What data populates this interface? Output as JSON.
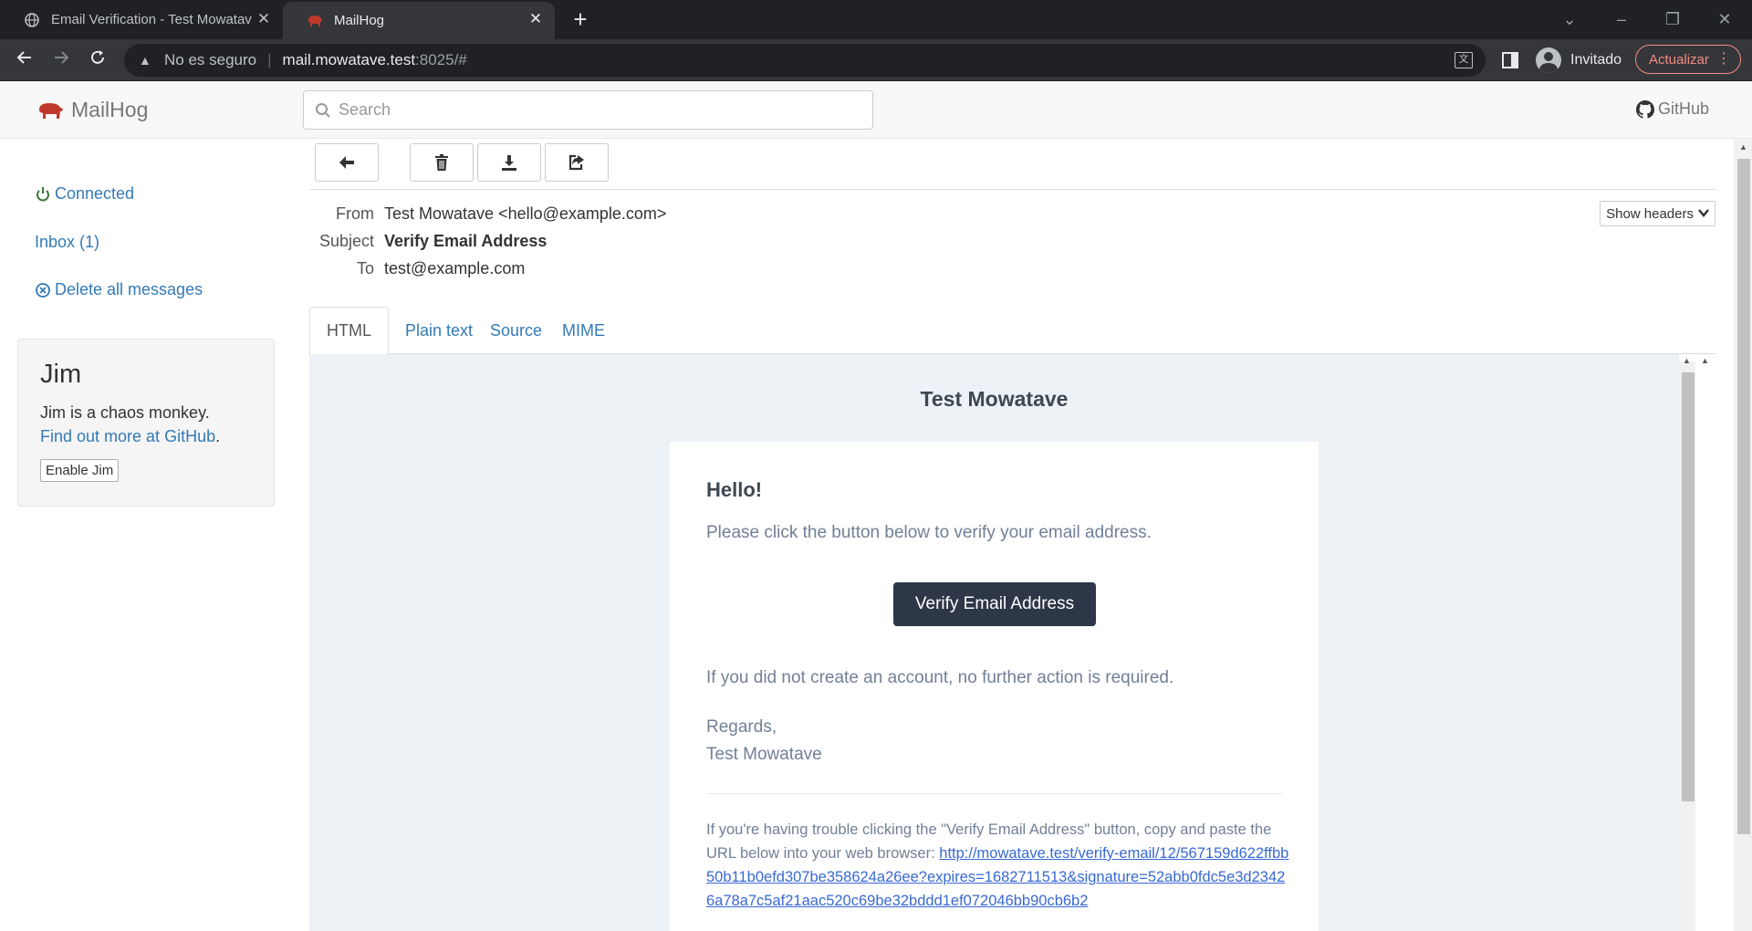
{
  "browser": {
    "tabs": [
      {
        "title": "Email Verification - Test Mowatave",
        "active": false
      },
      {
        "title": "MailHog",
        "active": true
      }
    ],
    "address": {
      "security": "No es seguro",
      "host": "mail.mowatave.test",
      "rest": ":8025/#"
    },
    "profile_name": "Invitado",
    "update_label": "Actualizar"
  },
  "mailhog": {
    "brand": "MailHog",
    "search_placeholder": "Search",
    "github_label": "GitHub",
    "sidebar": {
      "connected": "Connected",
      "inbox": "Inbox (1)",
      "delete_all": "Delete all messages"
    },
    "jim": {
      "title": "Jim",
      "text": "Jim is a chaos monkey.",
      "link": "Find out more at GitHub",
      "link_suffix": ".",
      "button": "Enable Jim"
    },
    "message": {
      "from_label": "From",
      "from": "Test Mowatave <hello@example.com>",
      "subject_label": "Subject",
      "subject": "Verify Email Address",
      "to_label": "To",
      "to": "test@example.com",
      "show_headers": "Show headers"
    },
    "tabs": [
      "HTML",
      "Plain text",
      "Source",
      "MIME"
    ],
    "email": {
      "app_name": "Test Mowatave",
      "greeting": "Hello!",
      "intro": "Please click the button below to verify your email address.",
      "button": "Verify Email Address",
      "outro": "If you did not create an account, no further action is required.",
      "regards": "Regards,",
      "signature": "Test Mowatave",
      "subcopy": "If you're having trouble clicking the \"Verify Email Address\" button, copy and paste the URL below into your web browser: ",
      "url": "http://mowatave.test/verify-email/12/567159d622ffbb50b11b0efd307be358624a26ee?expires=1682711513&signature=52abb0fdc5e3d23426a78a7c5af21aac520c69be32bddd1ef072046bb90cb6b2"
    }
  },
  "colors": {
    "link": "#337ab7",
    "connected": "#3c763d",
    "brand_pig": "#c0392b",
    "email_button": "#2d3748",
    "email_bg": "#edf2f7"
  }
}
